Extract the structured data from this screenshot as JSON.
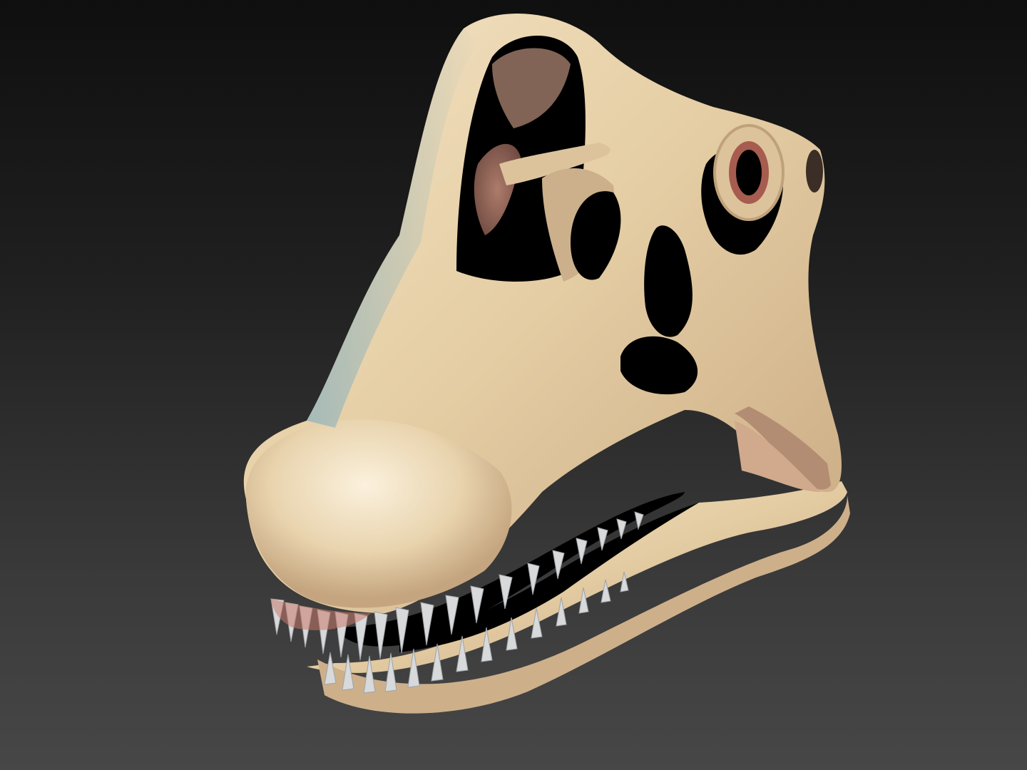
{
  "scene": {
    "subject": "sauropod-skull-3d-render",
    "colors": {
      "background_top": "#0f0f0f",
      "background_bottom": "#474747",
      "bone": "#e6cfa6",
      "bone_highlight": "#f7ebd2",
      "bone_shadow_cool": "#8fb3bd",
      "bone_shadow_warm": "#c98a72",
      "teeth": "#d7d9db",
      "cavity": "#000000"
    }
  }
}
